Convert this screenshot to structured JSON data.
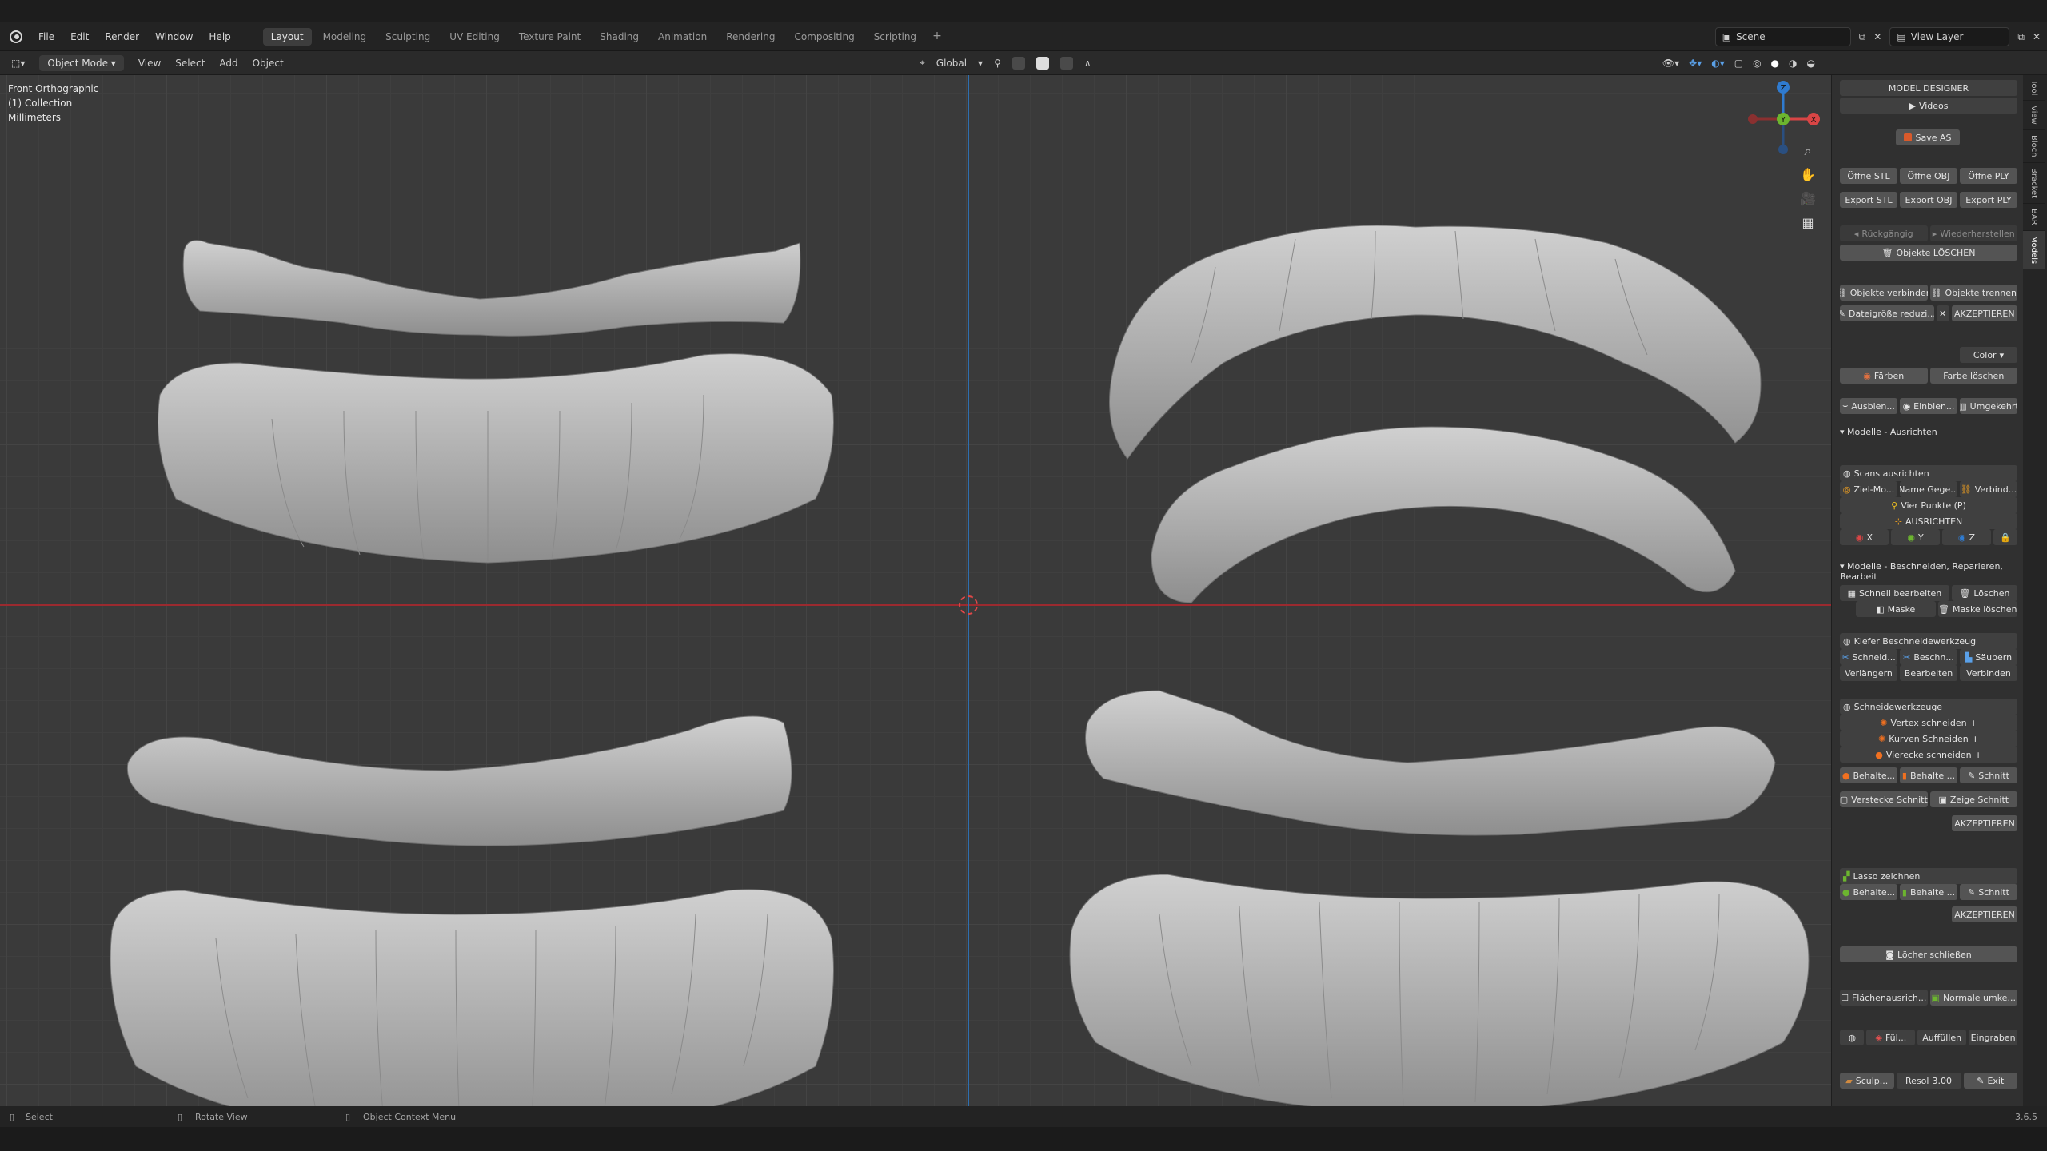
{
  "menu": [
    "File",
    "Edit",
    "Render",
    "Window",
    "Help"
  ],
  "workspaces": [
    "Layout",
    "Modeling",
    "Sculpting",
    "UV Editing",
    "Texture Paint",
    "Shading",
    "Animation",
    "Rendering",
    "Compositing",
    "Scripting"
  ],
  "active_workspace": "Layout",
  "scene": "Scene",
  "view_layer": "View Layer",
  "header": {
    "mode": "Object Mode",
    "items": [
      "View",
      "Select",
      "Add",
      "Object"
    ],
    "orientation": "Global"
  },
  "viewport": {
    "view_name": "Front Orthographic",
    "collection": "(1) Collection",
    "units": "Millimeters"
  },
  "gizmo": {
    "z": "Z",
    "y": "Y",
    "x": "X"
  },
  "panel": {
    "title": "MODEL DESIGNER",
    "videos": "Videos",
    "save_as": "Save AS",
    "open_stl": "Öffne STL",
    "open_obj": "Öffne OBJ",
    "open_ply": "Öffne PLY",
    "export_stl": "Export STL",
    "export_obj": "Export OBJ",
    "export_ply": "Export PLY",
    "undo": "Rückgängig",
    "redo": "Wiederherstellen",
    "delete_objects": "Objekte LÖSCHEN",
    "join_objects": "Objekte verbinden",
    "split_objects": "Objekte trennen",
    "reduce_size": "Dateigröße reduzi...",
    "accept": "AKZEPTIEREN",
    "color_label": "Color",
    "paint": "Färben",
    "clear_color": "Farbe löschen",
    "hide": "Ausblen...",
    "show": "Einblen...",
    "invert": "Umgekehrt",
    "section_align": "Modelle - Ausrichten",
    "align_scans": "Scans ausrichten",
    "target_model": "Ziel-Mo...",
    "name_counterpart": "Name Gege...",
    "connect": "Verbind...",
    "four_points": "Vier Punkte (P)",
    "align": "AUSRICHTEN",
    "axis_x": "X",
    "axis_y": "Y",
    "axis_z": "Z",
    "section_cut": "Modelle - Beschneiden, Reparieren, Bearbeit",
    "quick_edit": "Schnell bearbeiten",
    "delete": "Löschen",
    "mask": "Maske",
    "clear_mask": "Maske löschen",
    "jaw_cut_tool": "Kiefer Beschneidewerkzeug",
    "cut_a": "Schneid...",
    "cut_b": "Beschn...",
    "clean": "Säubern",
    "extend": "Verlängern",
    "edit": "Bearbeiten",
    "join": "Verbinden",
    "cut_tools": "Schneidewerkzeuge",
    "vertex_cut": "Vertex schneiden",
    "curve_cut": "Kurven Schneiden",
    "rect_cut": "Vierecke schneiden",
    "keep_a": "Behalte...",
    "keep_b": "Behalte ...",
    "cut": "Schnitt",
    "hide_cut": "Verstecke Schnitt",
    "show_cut": "Zeige Schnitt",
    "accept2": "AKZEPTIEREN",
    "lasso": "Lasso zeichnen",
    "keep_c": "Behalte...",
    "keep_d": "Behalte ...",
    "cut2": "Schnitt",
    "accept3": "AKZEPTIEREN",
    "close_holes": "Löcher schließen",
    "face_align": "Flächenausrich...",
    "flip_normals": "Normale umke...",
    "fill": "Fül...",
    "fill_up": "Auffüllen",
    "engrave": "Eingraben",
    "sculpt": "Sculp...",
    "resol_label": "Resol",
    "resol_value": "3.00",
    "exit": "Exit"
  },
  "tabs": [
    "Tool",
    "View",
    "Bloch",
    "Bracket",
    "BAR",
    "Models"
  ],
  "status": {
    "select": "Select",
    "rotate": "Rotate View",
    "context": "Object Context Menu",
    "version": "3.6.5"
  }
}
